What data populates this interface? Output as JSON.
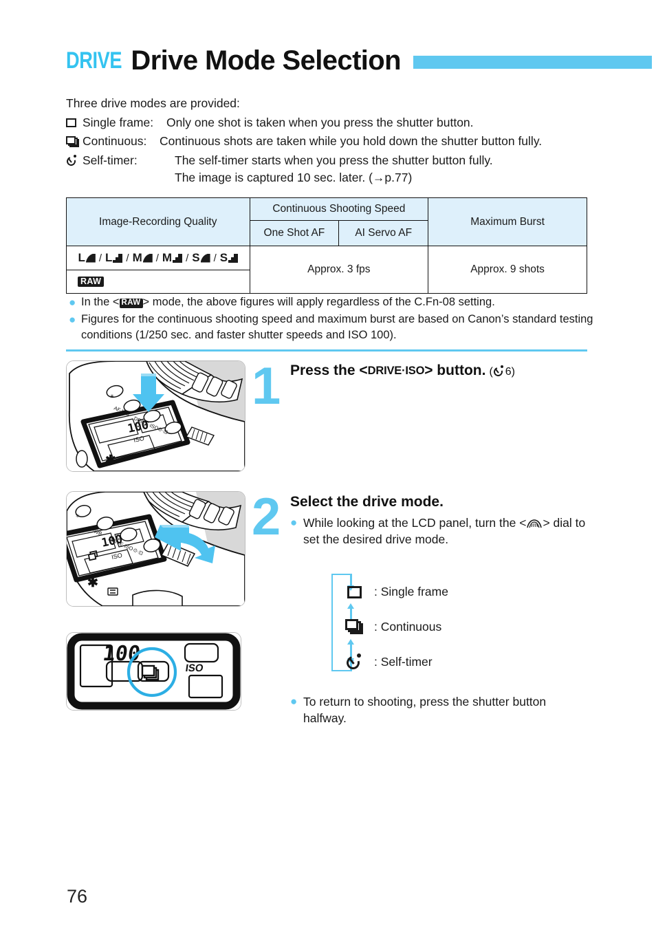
{
  "header": {
    "kicker": "DRIVE",
    "title": "Drive Mode Selection"
  },
  "intro": {
    "lead": "Three drive modes are provided:",
    "modes": [
      {
        "icon": "single-frame-icon",
        "name": "Single frame:",
        "desc": "Only one shot is taken when you press the shutter button."
      },
      {
        "icon": "continuous-icon",
        "name": "Continuous:",
        "desc": "Continuous shots are taken while you hold down the shutter button fully."
      },
      {
        "icon": "self-timer-icon",
        "name": "Self-timer:",
        "desc": "The self-timer starts when you press the shutter button fully.",
        "desc2": "The image is captured 10 sec. later. (→p.77)"
      }
    ]
  },
  "table": {
    "headers": {
      "quality": "Image-Recording Quality",
      "speed": "Continuous Shooting Speed",
      "one_shot": "One Shot AF",
      "ai_servo": "AI Servo AF",
      "burst": "Maximum Burst"
    },
    "quality_row": {
      "items": [
        {
          "size": "L",
          "glyph": "fine"
        },
        {
          "size": "L",
          "glyph": "normal"
        },
        {
          "size": "M",
          "glyph": "fine"
        },
        {
          "size": "M",
          "glyph": "normal"
        },
        {
          "size": "S",
          "glyph": "fine"
        },
        {
          "size": "S",
          "glyph": "normal"
        }
      ],
      "separator": "/",
      "raw_label": "RAW"
    },
    "fps": "Approx. 3 fps",
    "max_burst": "Approx. 9 shots"
  },
  "notes": [
    {
      "bullet": "●",
      "text_before": "In the <",
      "badge": "RAW",
      "text_after": "> mode, the above figures will apply regardless of the C.Fn-08 setting."
    },
    {
      "bullet": "●",
      "text": "Figures for the continuous shooting speed and maximum burst are based on Canon’s standard testing conditions (1/250 sec. and faster shutter speeds and ISO 100)."
    }
  ],
  "steps": [
    {
      "number": "1",
      "heading_before": "Press the <",
      "heading_button": "DRIVE·ISO",
      "heading_after": "> button.",
      "timer_note_open": "(",
      "timer_note_value": "6",
      "timer_note_close": ")",
      "illustration": "camera-top-view-press-drive-iso-button"
    },
    {
      "number": "2",
      "heading": "Select the drive mode.",
      "bullet": "●",
      "body_before": "While looking at the LCD panel, turn the <",
      "body_dial": "main-dial-glyph",
      "body_after": "> dial to set the desired drive mode.",
      "illustration": "camera-top-view-turn-main-dial"
    }
  ],
  "cycle": {
    "items": [
      {
        "icon": "single-frame-icon",
        "label": ": Single frame"
      },
      {
        "icon": "continuous-icon",
        "label": ": Continuous"
      },
      {
        "icon": "self-timer-icon",
        "label": ": Self-timer"
      }
    ]
  },
  "lcd_panel": {
    "iso_value": "100",
    "iso_label": "ISO",
    "highlighted_icon": "continuous-drive-icon",
    "highlight_color": "#2CAEE4"
  },
  "final_note": {
    "bullet": "●",
    "text": "To return to shooting, press the shutter button halfway."
  },
  "page_number": "76",
  "colors": {
    "accent": "#5FC8F0",
    "kicker": "#34C3F0",
    "table_header_bg": "#DEF0FB",
    "text": "#1a1a1a"
  }
}
